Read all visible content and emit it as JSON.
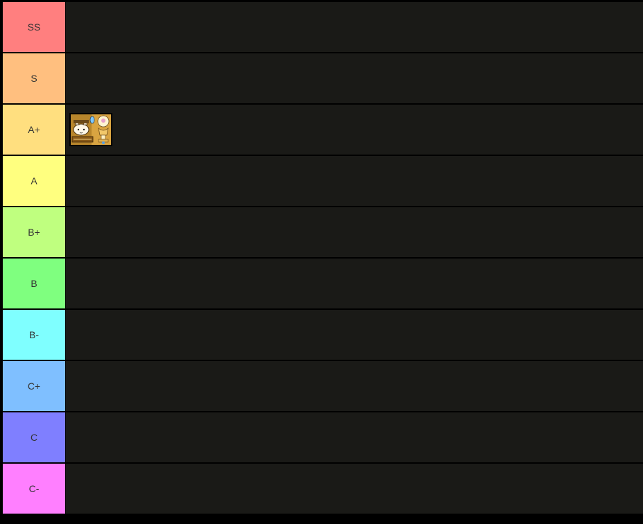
{
  "tiers": [
    {
      "label": "SS",
      "color": "#ff7f7f",
      "items": []
    },
    {
      "label": "S",
      "color": "#ffbf7f",
      "items": []
    },
    {
      "label": "A+",
      "color": "#ffdf7f",
      "items": [
        {
          "icon": "cat-unit-portrait-icon"
        }
      ]
    },
    {
      "label": "A",
      "color": "#ffff7f",
      "items": []
    },
    {
      "label": "B+",
      "color": "#bfff7f",
      "items": []
    },
    {
      "label": "B",
      "color": "#7fff7f",
      "items": []
    },
    {
      "label": "B-",
      "color": "#7fffff",
      "items": []
    },
    {
      "label": "C+",
      "color": "#7fbfff",
      "items": []
    },
    {
      "label": "C",
      "color": "#7f7fff",
      "items": []
    },
    {
      "label": "C-",
      "color": "#ff7fff",
      "items": []
    }
  ]
}
